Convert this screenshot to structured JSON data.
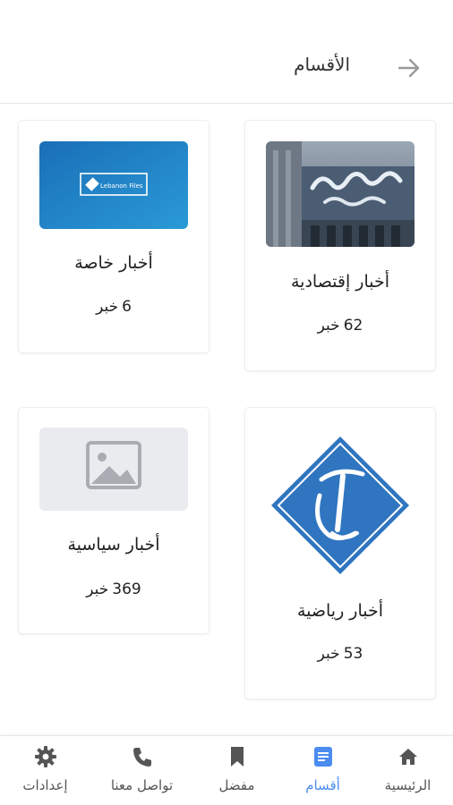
{
  "header": {
    "title": "الأقسام",
    "back_icon": "arrow-right-icon"
  },
  "categories": [
    {
      "title": "أخبار إقتصادية",
      "count": "62",
      "unit": "خبر",
      "image": "bank-building-photo"
    },
    {
      "title": "أخبار خاصة",
      "count": "6",
      "unit": "خبر",
      "image": "blue-logo-banner",
      "logo_text": "Lebanon Files"
    },
    {
      "title": "أخبار رياضية",
      "count": "53",
      "unit": "خبر",
      "image": "diamond-lt-logo"
    },
    {
      "title": "أخبار سياسية",
      "count": "369",
      "unit": "خبر",
      "image": "image-placeholder-icon"
    }
  ],
  "bottom_nav": {
    "items": [
      {
        "label": "الرئيسية",
        "icon": "home-icon",
        "active": false
      },
      {
        "label": "أقسام",
        "icon": "document-icon",
        "active": true
      },
      {
        "label": "مفضل",
        "icon": "bookmark-icon",
        "active": false
      },
      {
        "label": "تواصل معنا",
        "icon": "phone-icon",
        "active": false
      },
      {
        "label": "إعدادات",
        "icon": "gear-icon",
        "active": false
      }
    ]
  },
  "colors": {
    "accent": "#4a8cf0",
    "icon_gray": "#555555",
    "logo_blue": "#2f75c0",
    "banner_blue": "#1f84c8"
  }
}
